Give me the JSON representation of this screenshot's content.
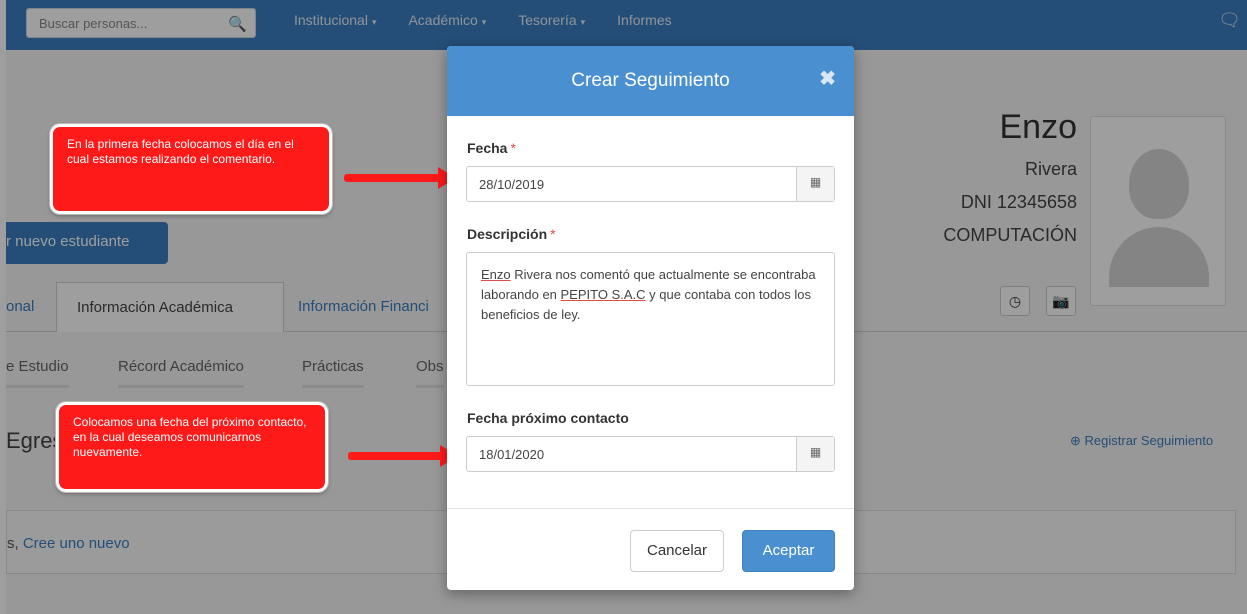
{
  "navbar": {
    "search_placeholder": "Buscar personas...",
    "search_icon": "search-icon",
    "menu": [
      {
        "label": "Institucional",
        "caret": "▾"
      },
      {
        "label": "Académico",
        "caret": "▾"
      },
      {
        "label": "Tesorería",
        "caret": "▾"
      },
      {
        "label": "Informes",
        "caret": ""
      }
    ],
    "chat_icon": "chat-icon"
  },
  "page": {
    "new_student_button": "r nuevo estudiante",
    "tabs": [
      "onal",
      "Información Académica",
      "Información Financi"
    ],
    "subtabs": [
      "e Estudio",
      "Récord Académico",
      "Prácticas",
      "Obs"
    ],
    "section_title": "Egres",
    "register_link": "Registrar Seguimiento",
    "empty_prefix": "s, ",
    "empty_link": "Cree uno nuevo"
  },
  "profile": {
    "name": "Enzo",
    "surname": "Rivera",
    "dni": "DNI 12345658",
    "career": "COMPUTACIÓN"
  },
  "callouts": {
    "first": "En la primera fecha colocamos el día en el cual estamos realizando el comentario.",
    "second": "Colocamos una fecha del próximo contacto, en la cual deseamos comunicarnos nuevamente."
  },
  "modal": {
    "title": "Crear Seguimiento",
    "close": "✖",
    "fecha_label": "Fecha",
    "fecha_value": "28/10/2019",
    "descripcion_label": "Descripción",
    "descripcion_value": {
      "w1": "Enzo",
      "t1": " Rivera nos comentó que actualmente se encontraba laborando en ",
      "w2": "PEPITO S.A.C",
      "t2": " y que contaba con todos los beneficios de ley."
    },
    "proximo_label": "Fecha próximo contacto",
    "proximo_value": "18/01/2020",
    "required_mark": "*",
    "cancel": "Cancelar",
    "accept": "Aceptar"
  }
}
